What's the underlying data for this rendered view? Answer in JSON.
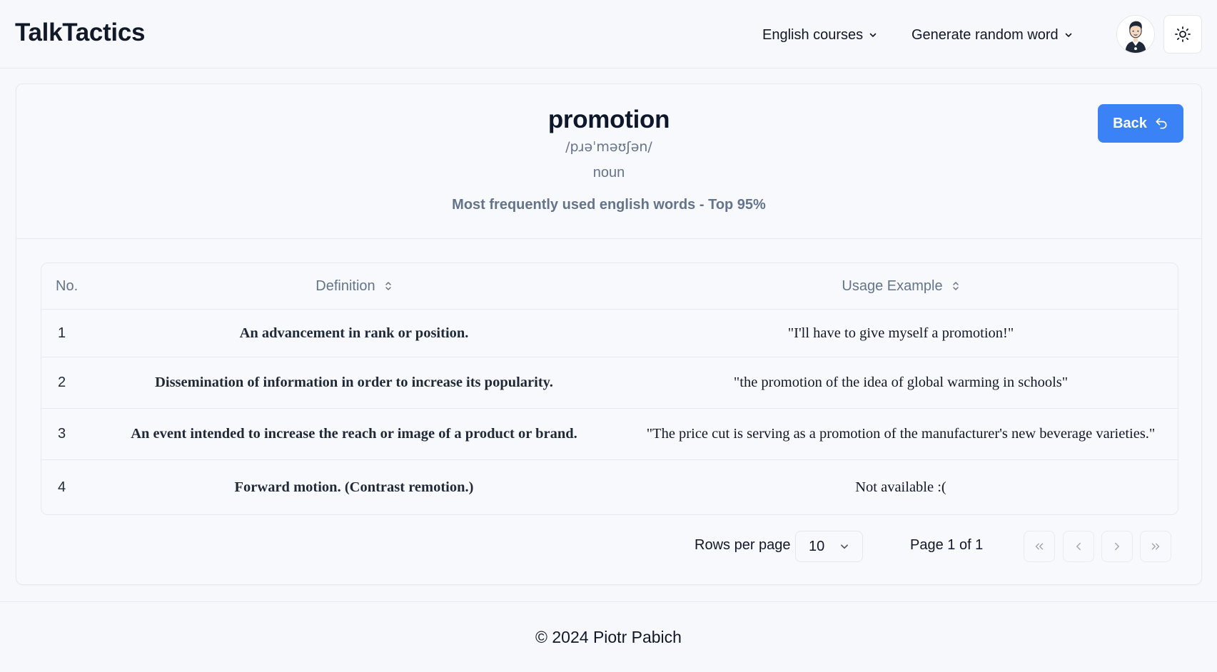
{
  "header": {
    "logo": "TalkTactics",
    "nav": {
      "courses_label": "English courses",
      "random_label": "Generate random word"
    },
    "avatar_icon": "user-avatar-icon",
    "theme_icon": "sun-icon"
  },
  "word": {
    "title": "promotion",
    "phonetic": "/pɹəˈməʊʃən/",
    "part_of_speech": "noun",
    "frequency": "Most frequently used english words - Top 95%",
    "back_label": "Back"
  },
  "table": {
    "headers": {
      "no": "No.",
      "definition": "Definition",
      "example": "Usage Example"
    },
    "rows": [
      {
        "no": "1",
        "definition": "An advancement in rank or position.",
        "example": "\"I'll have to give myself a promotion!\""
      },
      {
        "no": "2",
        "definition": "Dissemination of information in order to increase its popularity.",
        "example": "\"the promotion of the idea of global warming in schools\""
      },
      {
        "no": "3",
        "definition": "An event intended to increase the reach or image of a product or brand.",
        "example": "\"The price cut is serving as a promotion of the manufacturer's new beverage varieties.\""
      },
      {
        "no": "4",
        "definition": "Forward motion. (Contrast remotion.)",
        "example": "Not available :("
      }
    ]
  },
  "pagination": {
    "rows_per_page_label": "Rows per page",
    "rows_per_page_value": "10",
    "page_info": "Page 1 of 1"
  },
  "footer": {
    "text": "© 2024 Piotr Pabich"
  },
  "colors": {
    "accent": "#3b82f6",
    "background": "#f7f8fb",
    "muted_text": "#64748b"
  }
}
